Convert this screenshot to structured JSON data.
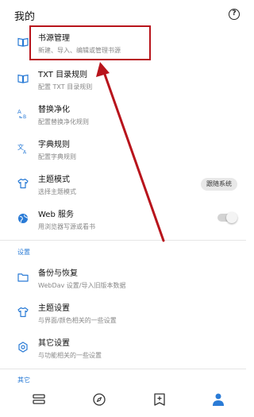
{
  "header": {
    "title": "我的",
    "help_icon": "help-circle-icon"
  },
  "items": [
    {
      "label": "书源管理",
      "desc": "新建、导入、编辑或管理书源",
      "icon": "book-source-icon"
    },
    {
      "label": "TXT 目录规则",
      "desc": "配置 TXT 目录规则",
      "icon": "toc-rule-icon"
    },
    {
      "label": "替换净化",
      "desc": "配置替换净化规则",
      "icon": "replace-icon"
    },
    {
      "label": "字典规则",
      "desc": "配置字典规则",
      "icon": "dictionary-icon"
    },
    {
      "label": "主题模式",
      "desc": "选择主题模式",
      "icon": "tshirt-icon",
      "chip": "跟随系统"
    },
    {
      "label": "Web 服务",
      "desc": "用浏览器写源或看书",
      "icon": "globe-icon",
      "toggle": false
    }
  ],
  "settings": {
    "title": "设置",
    "items": [
      {
        "label": "备份与恢复",
        "desc": "WebDav 设置/导入旧版本数据",
        "icon": "folder-icon"
      },
      {
        "label": "主题设置",
        "desc": "与界面/颜色相关的一些设置",
        "icon": "tshirt-icon"
      },
      {
        "label": "其它设置",
        "desc": "与功能相关的一些设置",
        "icon": "settings-icon"
      }
    ]
  },
  "other": {
    "title": "其它"
  },
  "bottom_nav": [
    {
      "name": "bookshelf",
      "icon": "bookshelf-icon"
    },
    {
      "name": "discover",
      "icon": "compass-icon"
    },
    {
      "name": "rss",
      "icon": "bookmark-icon"
    },
    {
      "name": "my",
      "icon": "person-icon",
      "active": true
    }
  ],
  "colors": {
    "accent": "#2a7bd6",
    "annotation": "#b8141c"
  }
}
